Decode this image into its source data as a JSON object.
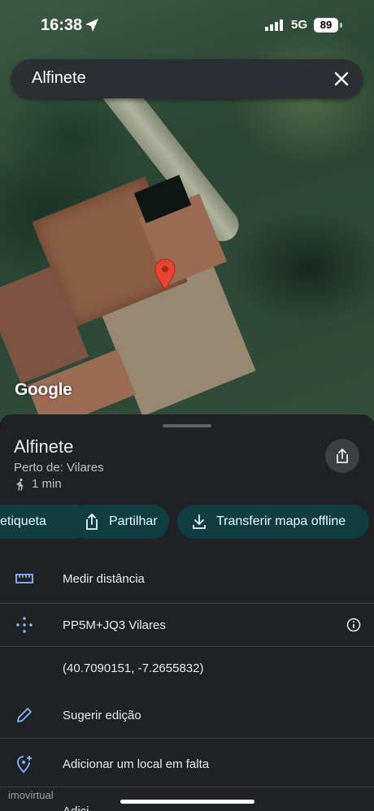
{
  "status_bar": {
    "time": "16:38",
    "network": "5G",
    "battery": "89"
  },
  "search": {
    "query": "Alfinete"
  },
  "map": {
    "attribution": "Google"
  },
  "place": {
    "name": "Alfinete",
    "nearby": "Perto de: Vilares",
    "walk_time": "1 min"
  },
  "chips": [
    {
      "label": "etiqueta",
      "icon": "label-icon"
    },
    {
      "label": "Partilhar",
      "icon": "share-icon"
    },
    {
      "label": "Transferir mapa offline",
      "icon": "download-icon"
    }
  ],
  "actions": {
    "measure": "Medir distância",
    "plus_code": "PP5M+JQ3 Vilares",
    "coordinates": "(40.7090151, -7.2655832)",
    "suggest_edit": "Sugerir edição",
    "add_place": "Adicionar um local em falta",
    "next_row_partial": "Adici"
  },
  "watermark": "imovirtual",
  "colors": {
    "sheet": "#202124",
    "chip": "#0f3d42",
    "pin": "#ea4335",
    "accent": "#8ab4f8"
  }
}
